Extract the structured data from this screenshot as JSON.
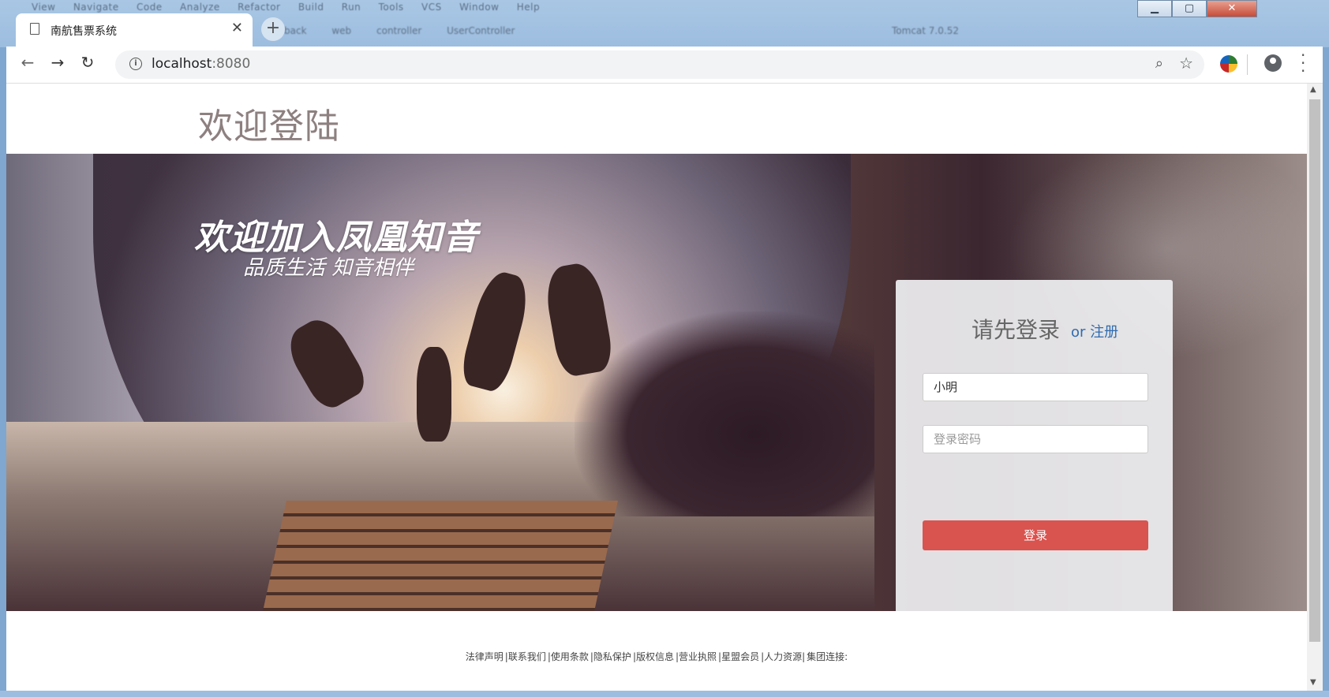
{
  "ide": {
    "menu": [
      "View",
      "Navigate",
      "Code",
      "Analyze",
      "Refactor",
      "Build",
      "Run",
      "Tools",
      "VCS",
      "Window",
      "Help"
    ],
    "breadcrumbs": [
      "back",
      "web",
      "controller",
      "UserController"
    ],
    "run_config": "Tomcat 7.0.52"
  },
  "browser": {
    "tab_title": "南航售票系统",
    "tab_close": "✕",
    "new_tab": "+",
    "url_host": "localhost",
    "url_port": ":8080"
  },
  "page": {
    "heading": "欢迎登陆",
    "hero_title": "欢迎加入凤凰知音",
    "hero_subtitle": "品质生活 知音相伴"
  },
  "login": {
    "title": "请先登录",
    "or_register": "or 注册",
    "username_value": "小明",
    "password_placeholder": "登录密码",
    "submit_label": "登录"
  },
  "footer": {
    "links": [
      "法律声明",
      "|联系我们",
      "|使用条款",
      "|隐私保护",
      "|版权信息",
      "|营业执照",
      "|星盟会员",
      "|人力资源|",
      "集团连接:"
    ]
  }
}
